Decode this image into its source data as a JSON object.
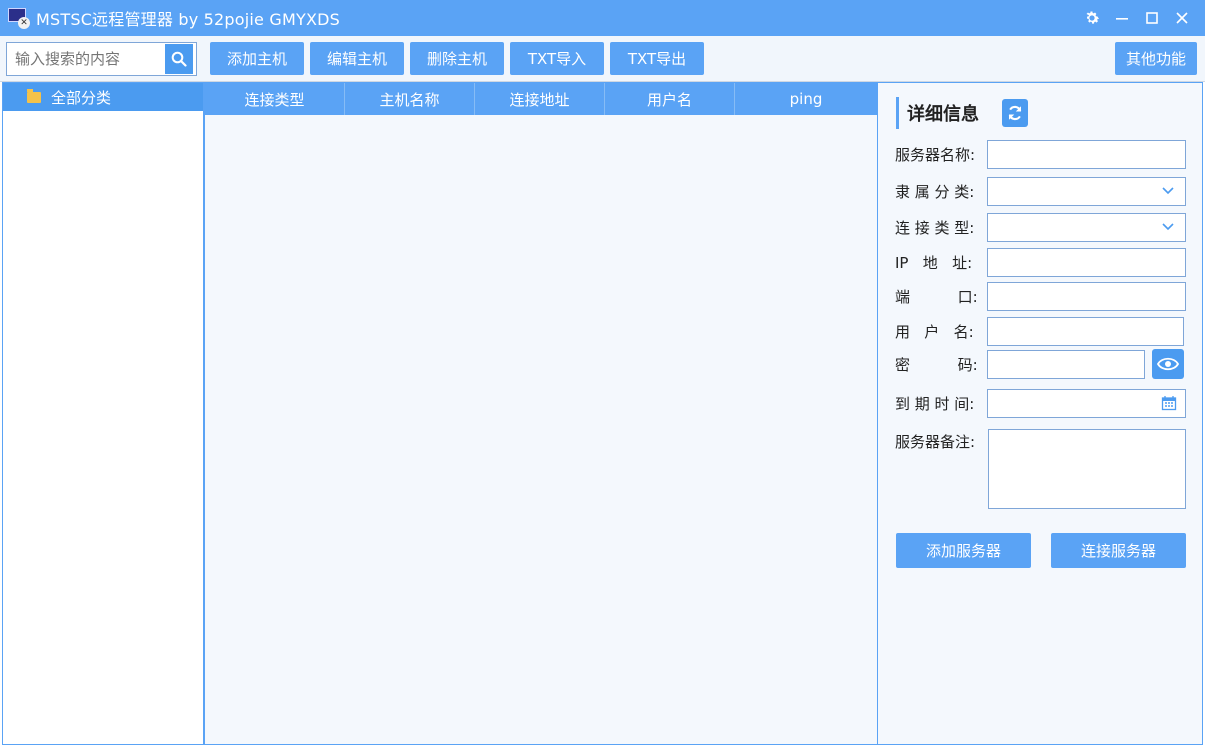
{
  "window": {
    "title": "MSTSC远程管理器  by 52pojie GMYXDS"
  },
  "search": {
    "placeholder": "输入搜索的内容"
  },
  "toolbar": {
    "add_host": "添加主机",
    "edit_host": "编辑主机",
    "delete_host": "删除主机",
    "txt_import": "TXT导入",
    "txt_export": "TXT导出",
    "other_functions": "其他功能"
  },
  "tree": {
    "items": [
      {
        "label": "全部分类",
        "icon": "folder-icon"
      }
    ]
  },
  "grid": {
    "columns": [
      "连接类型",
      "主机名称",
      "连接地址",
      "用户名",
      "ping"
    ],
    "rows": []
  },
  "detail": {
    "title": "详细信息",
    "fields": {
      "server_name": {
        "label": "服务器名称:",
        "value": ""
      },
      "category": {
        "label": "隶 属 分 类:",
        "value": ""
      },
      "connect_type": {
        "label": "连 接 类 型:",
        "value": ""
      },
      "ip": {
        "label": "IP   地   址:",
        "value": ""
      },
      "port": {
        "label": "端          口:",
        "value": ""
      },
      "username": {
        "label": "用   户   名:",
        "value": ""
      },
      "password": {
        "label": "密          码:",
        "value": ""
      },
      "expire": {
        "label": "到 期 时 间:",
        "value": ""
      },
      "notes": {
        "label": "服务器备注:",
        "value": ""
      }
    },
    "add_server": "添加服务器",
    "connect_server": "连接服务器"
  },
  "colors": {
    "accent": "#5aa3f5",
    "button": "#4b9bf0",
    "panel_bg": "#f4f8fd"
  }
}
